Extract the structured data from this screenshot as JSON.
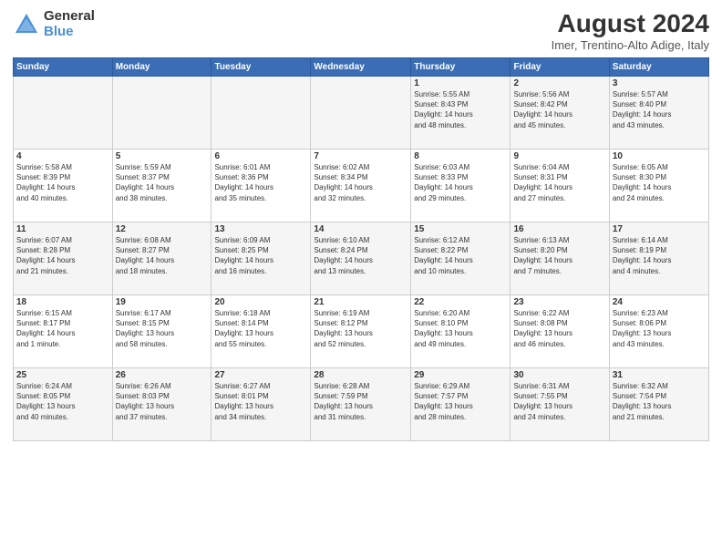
{
  "header": {
    "logo_general": "General",
    "logo_blue": "Blue",
    "main_title": "August 2024",
    "subtitle": "Imer, Trentino-Alto Adige, Italy"
  },
  "days_of_week": [
    "Sunday",
    "Monday",
    "Tuesday",
    "Wednesday",
    "Thursday",
    "Friday",
    "Saturday"
  ],
  "weeks": [
    [
      {
        "day": "",
        "info": ""
      },
      {
        "day": "",
        "info": ""
      },
      {
        "day": "",
        "info": ""
      },
      {
        "day": "",
        "info": ""
      },
      {
        "day": "1",
        "info": "Sunrise: 5:55 AM\nSunset: 8:43 PM\nDaylight: 14 hours\nand 48 minutes."
      },
      {
        "day": "2",
        "info": "Sunrise: 5:56 AM\nSunset: 8:42 PM\nDaylight: 14 hours\nand 45 minutes."
      },
      {
        "day": "3",
        "info": "Sunrise: 5:57 AM\nSunset: 8:40 PM\nDaylight: 14 hours\nand 43 minutes."
      }
    ],
    [
      {
        "day": "4",
        "info": "Sunrise: 5:58 AM\nSunset: 8:39 PM\nDaylight: 14 hours\nand 40 minutes."
      },
      {
        "day": "5",
        "info": "Sunrise: 5:59 AM\nSunset: 8:37 PM\nDaylight: 14 hours\nand 38 minutes."
      },
      {
        "day": "6",
        "info": "Sunrise: 6:01 AM\nSunset: 8:36 PM\nDaylight: 14 hours\nand 35 minutes."
      },
      {
        "day": "7",
        "info": "Sunrise: 6:02 AM\nSunset: 8:34 PM\nDaylight: 14 hours\nand 32 minutes."
      },
      {
        "day": "8",
        "info": "Sunrise: 6:03 AM\nSunset: 8:33 PM\nDaylight: 14 hours\nand 29 minutes."
      },
      {
        "day": "9",
        "info": "Sunrise: 6:04 AM\nSunset: 8:31 PM\nDaylight: 14 hours\nand 27 minutes."
      },
      {
        "day": "10",
        "info": "Sunrise: 6:05 AM\nSunset: 8:30 PM\nDaylight: 14 hours\nand 24 minutes."
      }
    ],
    [
      {
        "day": "11",
        "info": "Sunrise: 6:07 AM\nSunset: 8:28 PM\nDaylight: 14 hours\nand 21 minutes."
      },
      {
        "day": "12",
        "info": "Sunrise: 6:08 AM\nSunset: 8:27 PM\nDaylight: 14 hours\nand 18 minutes."
      },
      {
        "day": "13",
        "info": "Sunrise: 6:09 AM\nSunset: 8:25 PM\nDaylight: 14 hours\nand 16 minutes."
      },
      {
        "day": "14",
        "info": "Sunrise: 6:10 AM\nSunset: 8:24 PM\nDaylight: 14 hours\nand 13 minutes."
      },
      {
        "day": "15",
        "info": "Sunrise: 6:12 AM\nSunset: 8:22 PM\nDaylight: 14 hours\nand 10 minutes."
      },
      {
        "day": "16",
        "info": "Sunrise: 6:13 AM\nSunset: 8:20 PM\nDaylight: 14 hours\nand 7 minutes."
      },
      {
        "day": "17",
        "info": "Sunrise: 6:14 AM\nSunset: 8:19 PM\nDaylight: 14 hours\nand 4 minutes."
      }
    ],
    [
      {
        "day": "18",
        "info": "Sunrise: 6:15 AM\nSunset: 8:17 PM\nDaylight: 14 hours\nand 1 minute."
      },
      {
        "day": "19",
        "info": "Sunrise: 6:17 AM\nSunset: 8:15 PM\nDaylight: 13 hours\nand 58 minutes."
      },
      {
        "day": "20",
        "info": "Sunrise: 6:18 AM\nSunset: 8:14 PM\nDaylight: 13 hours\nand 55 minutes."
      },
      {
        "day": "21",
        "info": "Sunrise: 6:19 AM\nSunset: 8:12 PM\nDaylight: 13 hours\nand 52 minutes."
      },
      {
        "day": "22",
        "info": "Sunrise: 6:20 AM\nSunset: 8:10 PM\nDaylight: 13 hours\nand 49 minutes."
      },
      {
        "day": "23",
        "info": "Sunrise: 6:22 AM\nSunset: 8:08 PM\nDaylight: 13 hours\nand 46 minutes."
      },
      {
        "day": "24",
        "info": "Sunrise: 6:23 AM\nSunset: 8:06 PM\nDaylight: 13 hours\nand 43 minutes."
      }
    ],
    [
      {
        "day": "25",
        "info": "Sunrise: 6:24 AM\nSunset: 8:05 PM\nDaylight: 13 hours\nand 40 minutes."
      },
      {
        "day": "26",
        "info": "Sunrise: 6:26 AM\nSunset: 8:03 PM\nDaylight: 13 hours\nand 37 minutes."
      },
      {
        "day": "27",
        "info": "Sunrise: 6:27 AM\nSunset: 8:01 PM\nDaylight: 13 hours\nand 34 minutes."
      },
      {
        "day": "28",
        "info": "Sunrise: 6:28 AM\nSunset: 7:59 PM\nDaylight: 13 hours\nand 31 minutes."
      },
      {
        "day": "29",
        "info": "Sunrise: 6:29 AM\nSunset: 7:57 PM\nDaylight: 13 hours\nand 28 minutes."
      },
      {
        "day": "30",
        "info": "Sunrise: 6:31 AM\nSunset: 7:55 PM\nDaylight: 13 hours\nand 24 minutes."
      },
      {
        "day": "31",
        "info": "Sunrise: 6:32 AM\nSunset: 7:54 PM\nDaylight: 13 hours\nand 21 minutes."
      }
    ]
  ]
}
